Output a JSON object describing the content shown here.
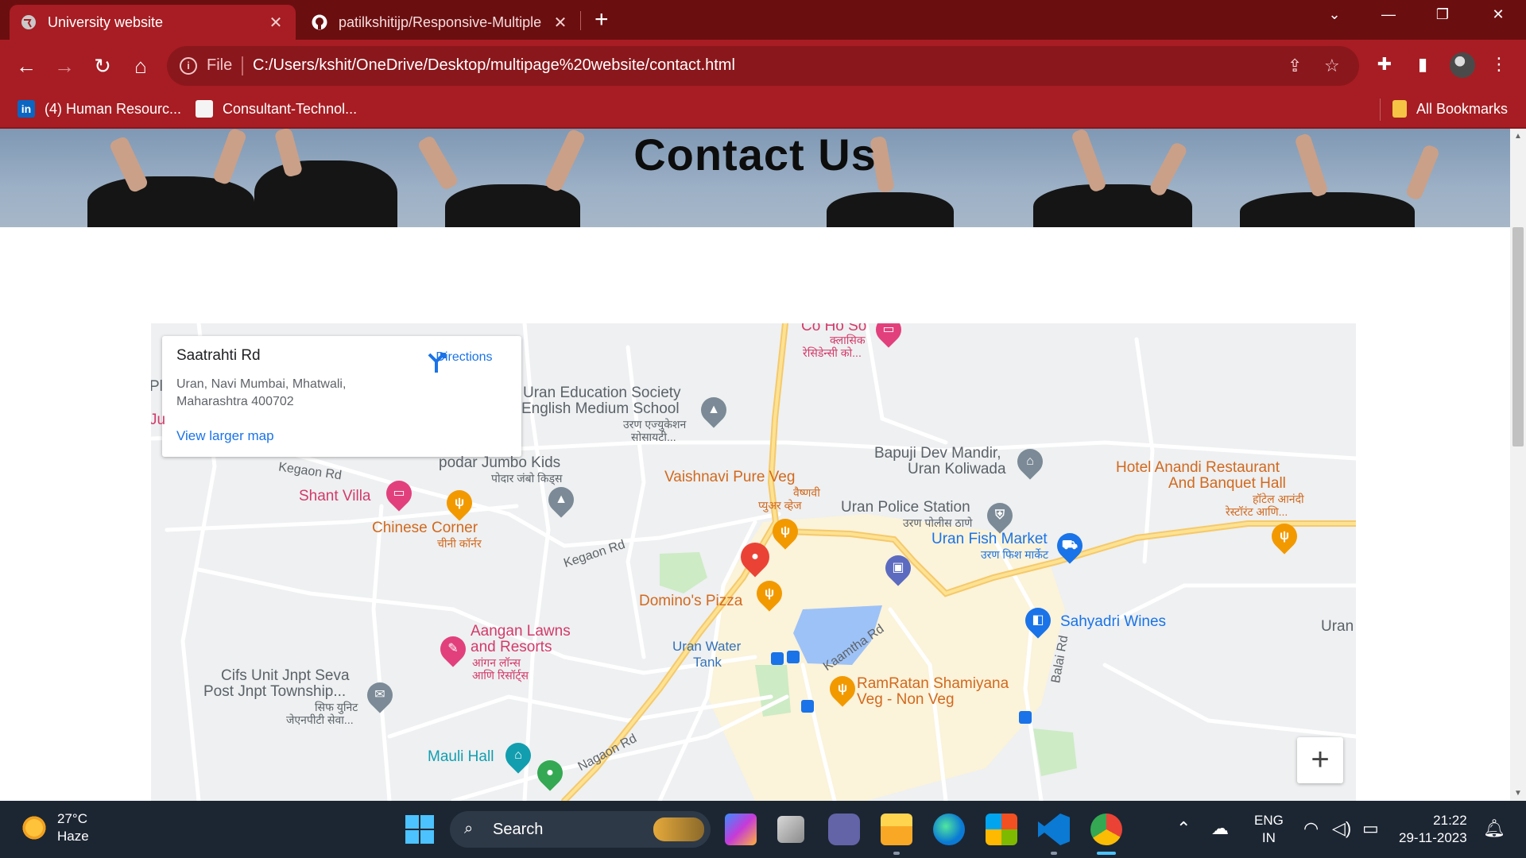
{
  "browser": {
    "tabs": [
      {
        "title": "University website",
        "active": true
      },
      {
        "title": "patilkshitijp/Responsive-Multiple",
        "active": false
      }
    ],
    "address": {
      "scheme": "File",
      "url": "C:/Users/kshit/OneDrive/Desktop/multipage%20website/contact.html"
    },
    "bookmarks": [
      {
        "label": "(4) Human Resourc...",
        "icon": "linkedin-icon"
      },
      {
        "label": "Consultant-Technol...",
        "icon": "page-icon"
      }
    ],
    "all_bookmarks": "All Bookmarks",
    "colors": {
      "frame": "#6b0e10",
      "toolbar": "#a71d23"
    }
  },
  "page": {
    "hero_title": "Contact Us"
  },
  "map": {
    "info_card": {
      "title": "Saatrahti Rd",
      "address": "Uran, Navi Mumbai, Mhatwali, Maharashtra 400702",
      "directions": "Directions",
      "view_larger": "View larger map"
    },
    "edge_labels": [
      "Pl",
      "Ju"
    ],
    "labels": {
      "coho": "Co Ho So",
      "coho_sub1": "क्लासिक",
      "coho_sub2": "रेसिडेन्सी को...",
      "school1": "Uran Education Society",
      "school2": "English Medium School",
      "school_sub1": "उरण एज्युकेशन",
      "school_sub2": "सोसायटी...",
      "podar": "podar Jumbo Kids",
      "podar_sub": "पोदार जंबो किड्स",
      "shant": "Shant Villa",
      "chinese": "Chinese Corner",
      "chinese_sub": "चीनी कॉर्नर",
      "vaishnavi": "Vaishnavi Pure Veg",
      "vaishnavi_sub1": "वैष्णवी",
      "vaishnavi_sub2": "प्युअर व्हेज",
      "bapuji1": "Bapuji Dev Mandir,",
      "bapuji2": "Uran Koliwada",
      "police": "Uran Police Station",
      "police_sub": "उरण पोलीस ठाणे",
      "hotel1": "Hotel Anandi Restaurant",
      "hotel2": "And Banquet Hall",
      "hotel_sub": "हॉटेल आनंदी",
      "hotel_sub2": "रेस्टॉरंट आणि...",
      "fish": "Uran Fish Market",
      "fish_sub": "उरण फिश मार्केट",
      "dominos": "Domino's Pizza",
      "sahyadri": "Sahyadri Wines",
      "uran": "Uran",
      "aangan1": "Aangan Lawns",
      "aangan2": "and Resorts",
      "aangan_sub1": "आंगन लॉन्स",
      "aangan_sub2": "आणि रिसॉर्ट्स",
      "water1": "Uran Water",
      "water2": "Tank",
      "ramratan1": "RamRatan Shamiyana",
      "ramratan2": "Veg - Non Veg",
      "cifs1": "Cifs Unit Jnpt Seva",
      "cifs2": "Post Jnpt Township...",
      "cifs_sub1": "सिफ युनिट",
      "cifs_sub2": "जेएनपीटी सेवा...",
      "mauli": "Mauli Hall"
    },
    "roads": {
      "kegaon1": "Kegaon Rd",
      "kegaon2": "Kegaon Rd",
      "kaamtha": "Kaamtha Rd",
      "nagaon": "Nagaon Rd",
      "balai": "Balai Rd"
    },
    "zoom_in": "+",
    "colors": {
      "food": "#d2691e",
      "pink": "#d33a6a",
      "blue": "#1a73e8",
      "marker": "#ea4335"
    }
  },
  "taskbar": {
    "weather_temp": "27°C",
    "weather_desc": "Haze",
    "search": "Search",
    "lang1": "ENG",
    "lang2": "IN",
    "time": "21:22",
    "date": "29-11-2023"
  }
}
